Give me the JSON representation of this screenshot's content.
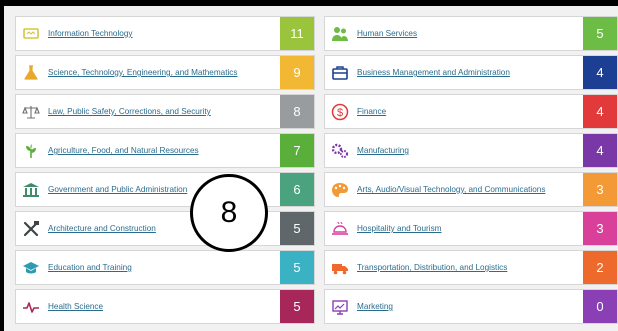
{
  "left_column": [
    {
      "label": "Information Technology",
      "count": "11",
      "color": "#9ac43c",
      "icon": "laptop-icon",
      "icon_color": "#d6c53a"
    },
    {
      "label": "Science, Technology, Engineering, and Mathematics",
      "count": "9",
      "color": "#f2b833",
      "icon": "flask-icon",
      "icon_color": "#e9a82a"
    },
    {
      "label": "Law, Public Safety, Corrections, and Security",
      "count": "8",
      "color": "#999c9e",
      "icon": "scales-icon",
      "icon_color": "#6c7074"
    },
    {
      "label": "Agriculture, Food, and Natural Resources",
      "count": "7",
      "color": "#5aaf3a",
      "icon": "plant-icon",
      "icon_color": "#5aaf3a"
    },
    {
      "label": "Government and Public Administration",
      "count": "6",
      "color": "#4aa27f",
      "icon": "building-icon",
      "icon_color": "#3f8c6c"
    },
    {
      "label": "Architecture and Construction",
      "count": "5",
      "color": "#5f676a",
      "icon": "tools-icon",
      "icon_color": "#3d4346"
    },
    {
      "label": "Education and Training",
      "count": "5",
      "color": "#3bb2c4",
      "icon": "graduation-cap-icon",
      "icon_color": "#2d9bb1"
    },
    {
      "label": "Health Science",
      "count": "5",
      "color": "#a8275b",
      "icon": "heartbeat-icon",
      "icon_color": "#a8275b"
    }
  ],
  "right_column": [
    {
      "label": "Human Services",
      "count": "5",
      "color": "#6cbc45",
      "icon": "people-icon",
      "icon_color": "#6cbc45"
    },
    {
      "label": "Business Management and Administration",
      "count": "4",
      "color": "#1c3f94",
      "icon": "briefcase-icon",
      "icon_color": "#1c3f94"
    },
    {
      "label": "Finance",
      "count": "4",
      "color": "#e23a3a",
      "icon": "dollar-icon",
      "icon_color": "#e23a3a"
    },
    {
      "label": "Manufacturing",
      "count": "4",
      "color": "#7a37a6",
      "icon": "gears-icon",
      "icon_color": "#7a37a6"
    },
    {
      "label": "Arts, Audio/Visual Technology, and Communications",
      "count": "3",
      "color": "#f39a36",
      "icon": "palette-icon",
      "icon_color": "#f39a36"
    },
    {
      "label": "Hospitality and Tourism",
      "count": "3",
      "color": "#d9409a",
      "icon": "food-tray-icon",
      "icon_color": "#d9409a"
    },
    {
      "label": "Transportation, Distribution, and Logistics",
      "count": "2",
      "color": "#ee6a2c",
      "icon": "truck-icon",
      "icon_color": "#ee6a2c"
    },
    {
      "label": "Marketing",
      "count": "0",
      "color": "#8a3fb5",
      "icon": "chart-monitor-icon",
      "icon_color": "#8a3fb5"
    }
  ],
  "overlay": {
    "label": "8"
  }
}
